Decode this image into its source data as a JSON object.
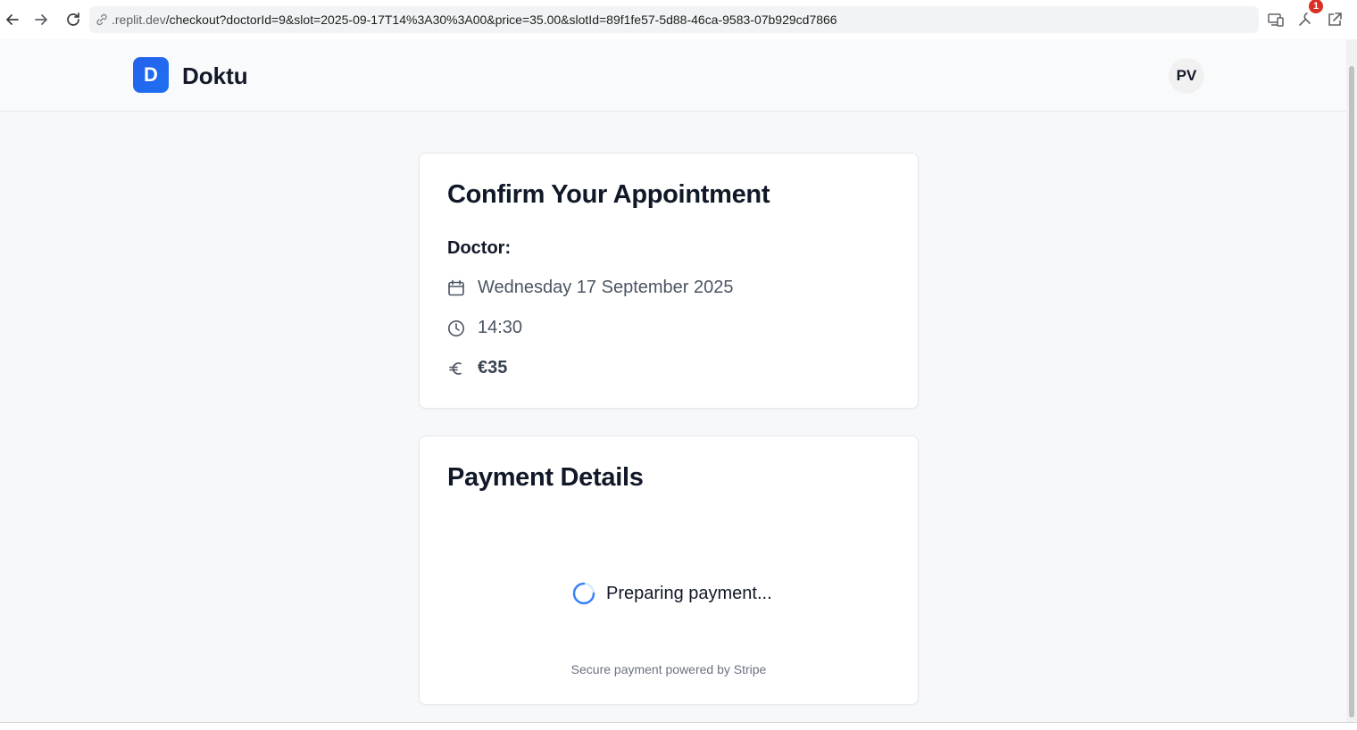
{
  "browser": {
    "url_host": ".replit.dev",
    "url_path": "/checkout?doctorId=9&slot=2025-09-17T14%3A30%3A00&price=35.00&slotId=89f1fe57-5d88-46ca-9583-07b929cd7866",
    "extension_badge": "1"
  },
  "header": {
    "logo_letter": "D",
    "brand": "Doktu",
    "avatar_initials": "PV"
  },
  "appointment": {
    "title": "Confirm Your Appointment",
    "doctor_label": "Doctor:",
    "date": "Wednesday 17 September 2025",
    "time": "14:30",
    "price": "€35"
  },
  "payment": {
    "title": "Payment Details",
    "status": "Preparing payment...",
    "secure_note": "Secure payment powered by Stripe"
  },
  "colors": {
    "brand_blue": "#2563eb",
    "spinner_blue": "#3b82f6",
    "badge_red": "#d93025"
  },
  "icons": {
    "date": "calendar-icon",
    "time": "clock-icon",
    "price": "euro-icon"
  }
}
